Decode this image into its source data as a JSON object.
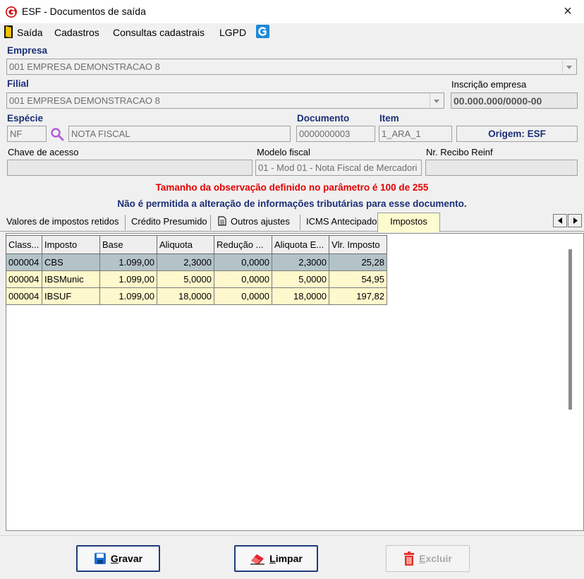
{
  "window": {
    "title": "ESF - Documentos de saída",
    "close": "×"
  },
  "menu": {
    "items": [
      "Saída",
      "Cadastros",
      "Consultas cadastrais",
      "LGPD"
    ]
  },
  "empresa": {
    "label": "Empresa",
    "value": "001 EMPRESA DEMONSTRACAO 8"
  },
  "filial": {
    "label": "Filial",
    "value": "001 EMPRESA DEMONSTRACAO 8"
  },
  "inscricao": {
    "label": "Inscrição empresa",
    "value": "00.000.000/0000-00"
  },
  "especie": {
    "label": "Espécie",
    "code": "NF",
    "name": "NOTA FISCAL"
  },
  "documento": {
    "label": "Documento",
    "value": "0000000003"
  },
  "item": {
    "label": "Item",
    "value": "1_ARA_1"
  },
  "origem": {
    "value": "Origem: ESF"
  },
  "chave": {
    "label": "Chave de acesso",
    "value": ""
  },
  "modelo": {
    "label": "Modelo fiscal",
    "value": "01 - Mod 01 - Nota Fiscal de Mercadori"
  },
  "recibo": {
    "label": "Nr. Recibo Reinf",
    "value": ""
  },
  "messages": {
    "obs": "Tamanho da observação definido no parâmetro é 100 de 255",
    "readonly": "Não é permitida a alteração de informações tributárias para esse documento."
  },
  "tabs": [
    {
      "label": "Valores de impostos retidos"
    },
    {
      "label": "Crédito Presumido"
    },
    {
      "label": "Outros ajustes"
    },
    {
      "label": "ICMS Antecipado"
    },
    {
      "label": "Impostos"
    }
  ],
  "grid": {
    "columns": [
      "Class...",
      "Imposto",
      "Base",
      "Aliquota",
      "Redução ...",
      "Aliquota E...",
      "Vlr. Imposto"
    ],
    "rows": [
      [
        "000004",
        "CBS",
        "1.099,00",
        "2,3000",
        "0,0000",
        "2,3000",
        "25,28"
      ],
      [
        "000004",
        "IBSMunic",
        "1.099,00",
        "5,0000",
        "0,0000",
        "5,0000",
        "54,95"
      ],
      [
        "000004",
        "IBSUF",
        "1.099,00",
        "18,0000",
        "0,0000",
        "18,0000",
        "197,82"
      ]
    ]
  },
  "buttons": {
    "gravar": {
      "accel": "G",
      "rest": "ravar"
    },
    "limpar": {
      "accel": "L",
      "rest": "impar"
    },
    "excluir": {
      "accel": "E",
      "rest": "xcluir"
    }
  },
  "colors": {
    "label_blue": "#1b2f76",
    "message_red": "#e40000",
    "selected_row": "#b3c3c8",
    "row_yellow": "#fff8cc",
    "active_tab": "#fffbd0"
  }
}
